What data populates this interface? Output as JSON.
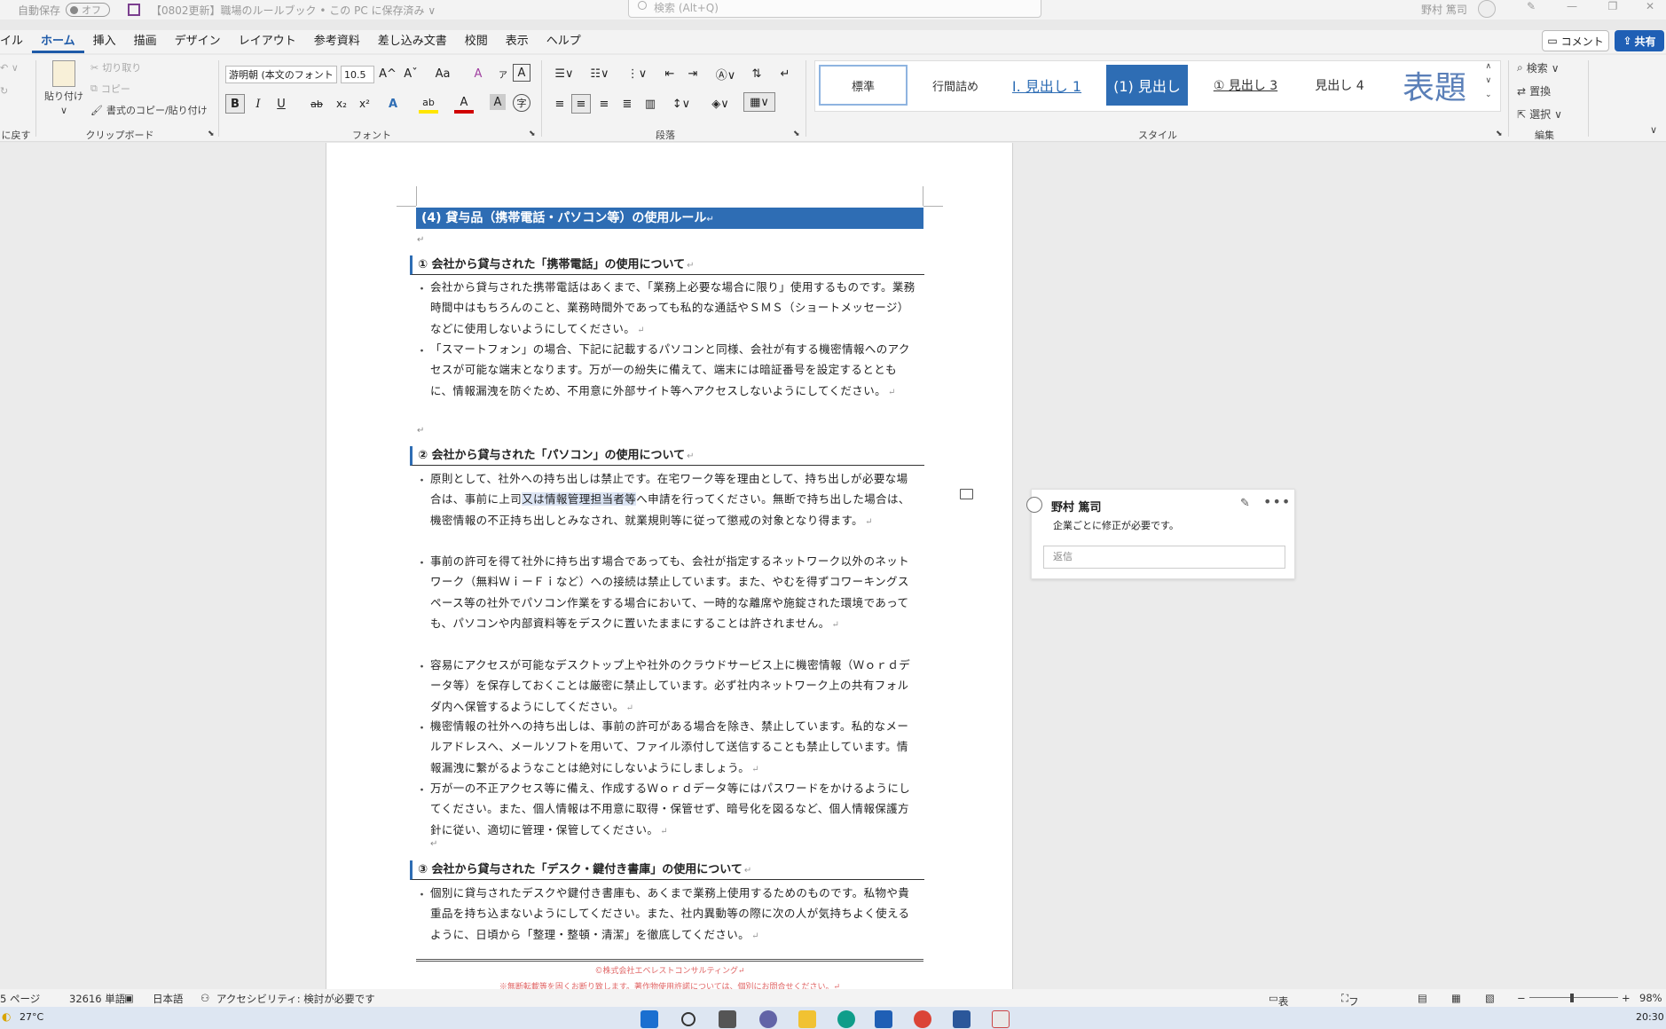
{
  "titlebar": {
    "autosave_label": "自動保存",
    "autosave_state": "オフ",
    "doc_title": "【0802更新】職場のルールブック • この PC に保存済み",
    "doc_title_caret": "∨",
    "search_placeholder": "検索 (Alt+Q)",
    "user_name": "野村 篤司",
    "minimize": "—",
    "restore": "❐",
    "close": "✕"
  },
  "menu": {
    "tabs": [
      "イル",
      "ホーム",
      "挿入",
      "描画",
      "デザイン",
      "レイアウト",
      "参考資料",
      "差し込み文書",
      "校閲",
      "表示",
      "ヘルプ"
    ],
    "active_tab": "ホーム",
    "comment_button": "コメント",
    "share_button": "共有"
  },
  "ribbon": {
    "undo_label": "に戻す",
    "clipboard": {
      "paste": "貼り付け",
      "cut": "切り取り",
      "copy": "コピー",
      "format_painter": "書式のコピー/貼り付け",
      "group_label": "クリップボード"
    },
    "font": {
      "font_name": "游明朝 (本文のフォント",
      "font_size": "10.5",
      "group_label": "フォント",
      "bold": "B",
      "italic": "I",
      "underline": "U",
      "strike": "ab",
      "subscript": "x₂",
      "superscript": "x²",
      "grow": "A^",
      "shrink": "Aˇ",
      "case": "Aa",
      "clear": "A",
      "effects": "A",
      "highlight": "ab",
      "color": "A",
      "char_shade": "A",
      "enclose": "字"
    },
    "paragraph": {
      "group_label": "段落"
    },
    "styles": {
      "group_label": "スタイル",
      "items": [
        "標準",
        "行間詰め",
        "Ⅰ. 見出し 1",
        "(1) 見出し",
        "① 見出し 3",
        "見出し 4",
        "表題"
      ]
    },
    "editing": {
      "group_label": "編集",
      "find": "検索",
      "replace": "置換",
      "select": "選択"
    }
  },
  "document": {
    "heading1": "(4) 貸与品（携帯電話・パソコン等）の使用ルール",
    "sections": [
      {
        "heading": "① 会社から貸与された「携帯電話」の使用について",
        "bullets": [
          "会社から貸与された携帯電話はあくまで、「業務上必要な場合に限り」使用するものです。業務時間中はもちろんのこと、業務時間外であっても私的な通話やＳＭＳ（ショートメッセージ）などに使用しないようにしてください。",
          "「スマートフォン」の場合、下記に記載するパソコンと同様、会社が有する機密情報へのアクセスが可能な端末となります。万が一の紛失に備えて、端末には暗証番号を設定するとともに、情報漏洩を防ぐため、不用意に外部サイト等へアクセスしないようにしてください。"
        ]
      },
      {
        "heading": "② 会社から貸与された「パソコン」の使用について",
        "bullets": [
          "原則として、社外への持ち出しは禁止です。在宅ワーク等を理由として、持ち出しが必要な場合は、事前に上司",
          "又は情報管理担当者等",
          "へ申請を行ってください。無断で持ち出した場合は、機密情報の不正持ち出しとみなされ、就業規則等に従って懲戒の対象となり得ます。",
          "事前の許可を得て社外に持ち出す場合であっても、会社が指定するネットワーク以外のネットワーク（無料ＷｉーＦｉなど）への接続は禁止しています。また、やむを得ずコワーキングスペース等の社外でパソコン作業をする場合において、一時的な離席や施錠された環境であっても、パソコンや内部資料等をデスクに置いたままにすることは許されません。",
          "容易にアクセスが可能なデスクトップ上や社外のクラウドサービス上に機密情報（Ｗｏｒｄデータ等）を保存しておくことは厳密に禁止しています。必ず社内ネットワーク上の共有フォルダ内へ保管するようにしてください。",
          "機密情報の社外への持ち出しは、事前の許可がある場合を除き、禁止しています。私的なメールアドレスへ、メールソフトを用いて、ファイル添付して送信することも禁止しています。情報漏洩に繋がるようなことは絶対にしないようにしましょう。",
          "万が一の不正アクセス等に備え、作成するＷｏｒｄデータ等にはパスワードをかけるようにしてください。また、個人情報は不用意に取得・保管せず、暗号化を図るなど、個人情報保護方針に従い、適切に管理・保管してください。"
        ]
      },
      {
        "heading": "③ 会社から貸与された「デスク・鍵付き書庫」の使用について",
        "bullets": [
          "個別に貸与されたデスクや鍵付き書庫も、あくまで業務上使用するためのものです。私物や貴重品を持ち込まないようにしてください。また、社内異動等の際に次の人が気持ちよく使えるように、日頃から「整理・整頓・清潔」を徹底してください。"
        ]
      }
    ],
    "return_mark": "↵",
    "footer_copy": "©株式会社エベレストコンサルティング↵",
    "footer_note": "※無断転載等を固くお断り致します。著作物使用許諾については、個別にお問合せください。↵"
  },
  "comment": {
    "author": "野村 篤司",
    "body": "企業ごとに修正が必要です。",
    "reply_placeholder": "返信",
    "more": "•••",
    "edit": "✎"
  },
  "status": {
    "page": "5 ページ",
    "words": "32616 単語",
    "language": "日本語",
    "accessibility": "アクセシビリティ: 検討が必要です",
    "display_settings": "表示設定",
    "focus": "フォーカス",
    "zoom": "98%",
    "zoom_minus": "−",
    "zoom_plus": "+"
  },
  "taskbar": {
    "temperature": "27°C",
    "time": "20:30"
  },
  "colors": {
    "accent": "#2e6db4",
    "share": "#1f5fb5",
    "footer_red": "#e06666"
  }
}
